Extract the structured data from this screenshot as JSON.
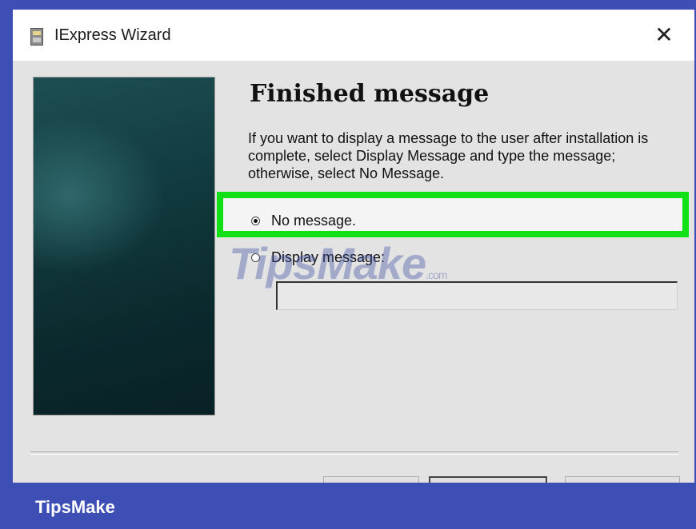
{
  "window": {
    "title": "IExpress Wizard",
    "icon": "app-icon",
    "close_glyph": "✕"
  },
  "page": {
    "heading": "Finished message",
    "description": "If you want to display a message to the user after installation is complete, select Display Message and type the message; otherwise, select No Message."
  },
  "options": {
    "no_message": {
      "label": "No message.",
      "selected": true
    },
    "display_message": {
      "label": "Display message:",
      "selected": false
    }
  },
  "message_field": {
    "value": ""
  },
  "highlight": {
    "color": "#10e015"
  },
  "watermark": {
    "text": "TipsMake",
    "suffix": ".com"
  },
  "footer": {
    "brand": "TipsMake",
    "background": "#3d4fb4"
  }
}
